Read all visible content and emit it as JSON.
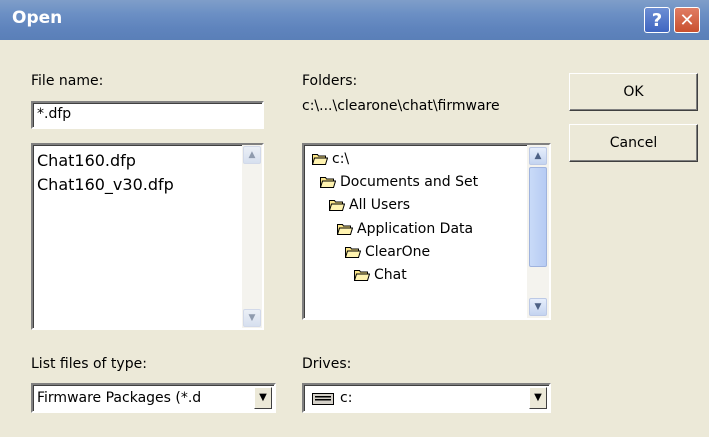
{
  "window": {
    "title": "Open",
    "help_glyph": "?",
    "close_glyph": "✕"
  },
  "file_name": {
    "label": "File name:",
    "value": "*.dfp"
  },
  "files": [
    "Chat160.dfp",
    "Chat160_v30.dfp"
  ],
  "folders": {
    "label": "Folders:",
    "path": "c:\\...\\clearone\\chat\\firmware",
    "items": [
      "c:\\",
      "Documents and Set",
      "All Users",
      "Application Data",
      "ClearOne",
      "Chat"
    ]
  },
  "buttons": {
    "ok": "OK",
    "cancel": "Cancel"
  },
  "file_type": {
    "label": "List files of type:",
    "value": "Firmware Packages  (*.d"
  },
  "drives": {
    "label": "Drives:",
    "value": "c:"
  },
  "icons": {
    "folder": "open-folder-icon",
    "drive": "drive-icon",
    "arrow": "dropdown-arrow-icon"
  },
  "colors": {
    "titlebar": "#6b8fc4",
    "dialog": "#ece9d8",
    "close": "#c9502f"
  }
}
